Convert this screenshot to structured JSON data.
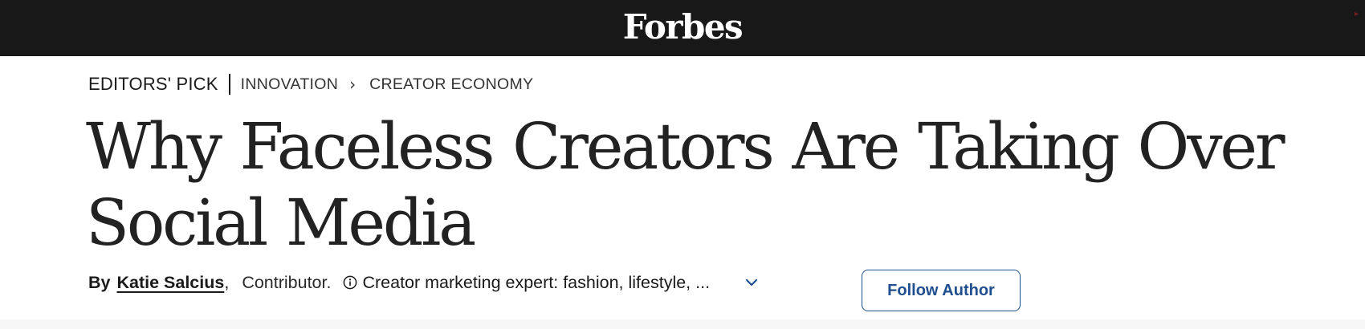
{
  "header": {
    "logo_text": "Forbes",
    "background": "#181818"
  },
  "breadcrumb": {
    "label": "EDITORS' PICK",
    "section": "INNOVATION",
    "subsection": "CREATOR ECONOMY"
  },
  "article": {
    "headline": "Why Faceless Creators Are Taking Over Social Media"
  },
  "byline": {
    "prefix": "By",
    "author": "Katie Salcius",
    "comma": ",",
    "role": "Contributor.",
    "bio": "Creator marketing expert: fashion, lifestyle, ...",
    "info_icon": "info-icon",
    "expand_icon": "chevron-down-icon",
    "follow_label": "Follow Author"
  },
  "colors": {
    "accent": "#1f4f8f",
    "text": "#1a1a1a"
  }
}
